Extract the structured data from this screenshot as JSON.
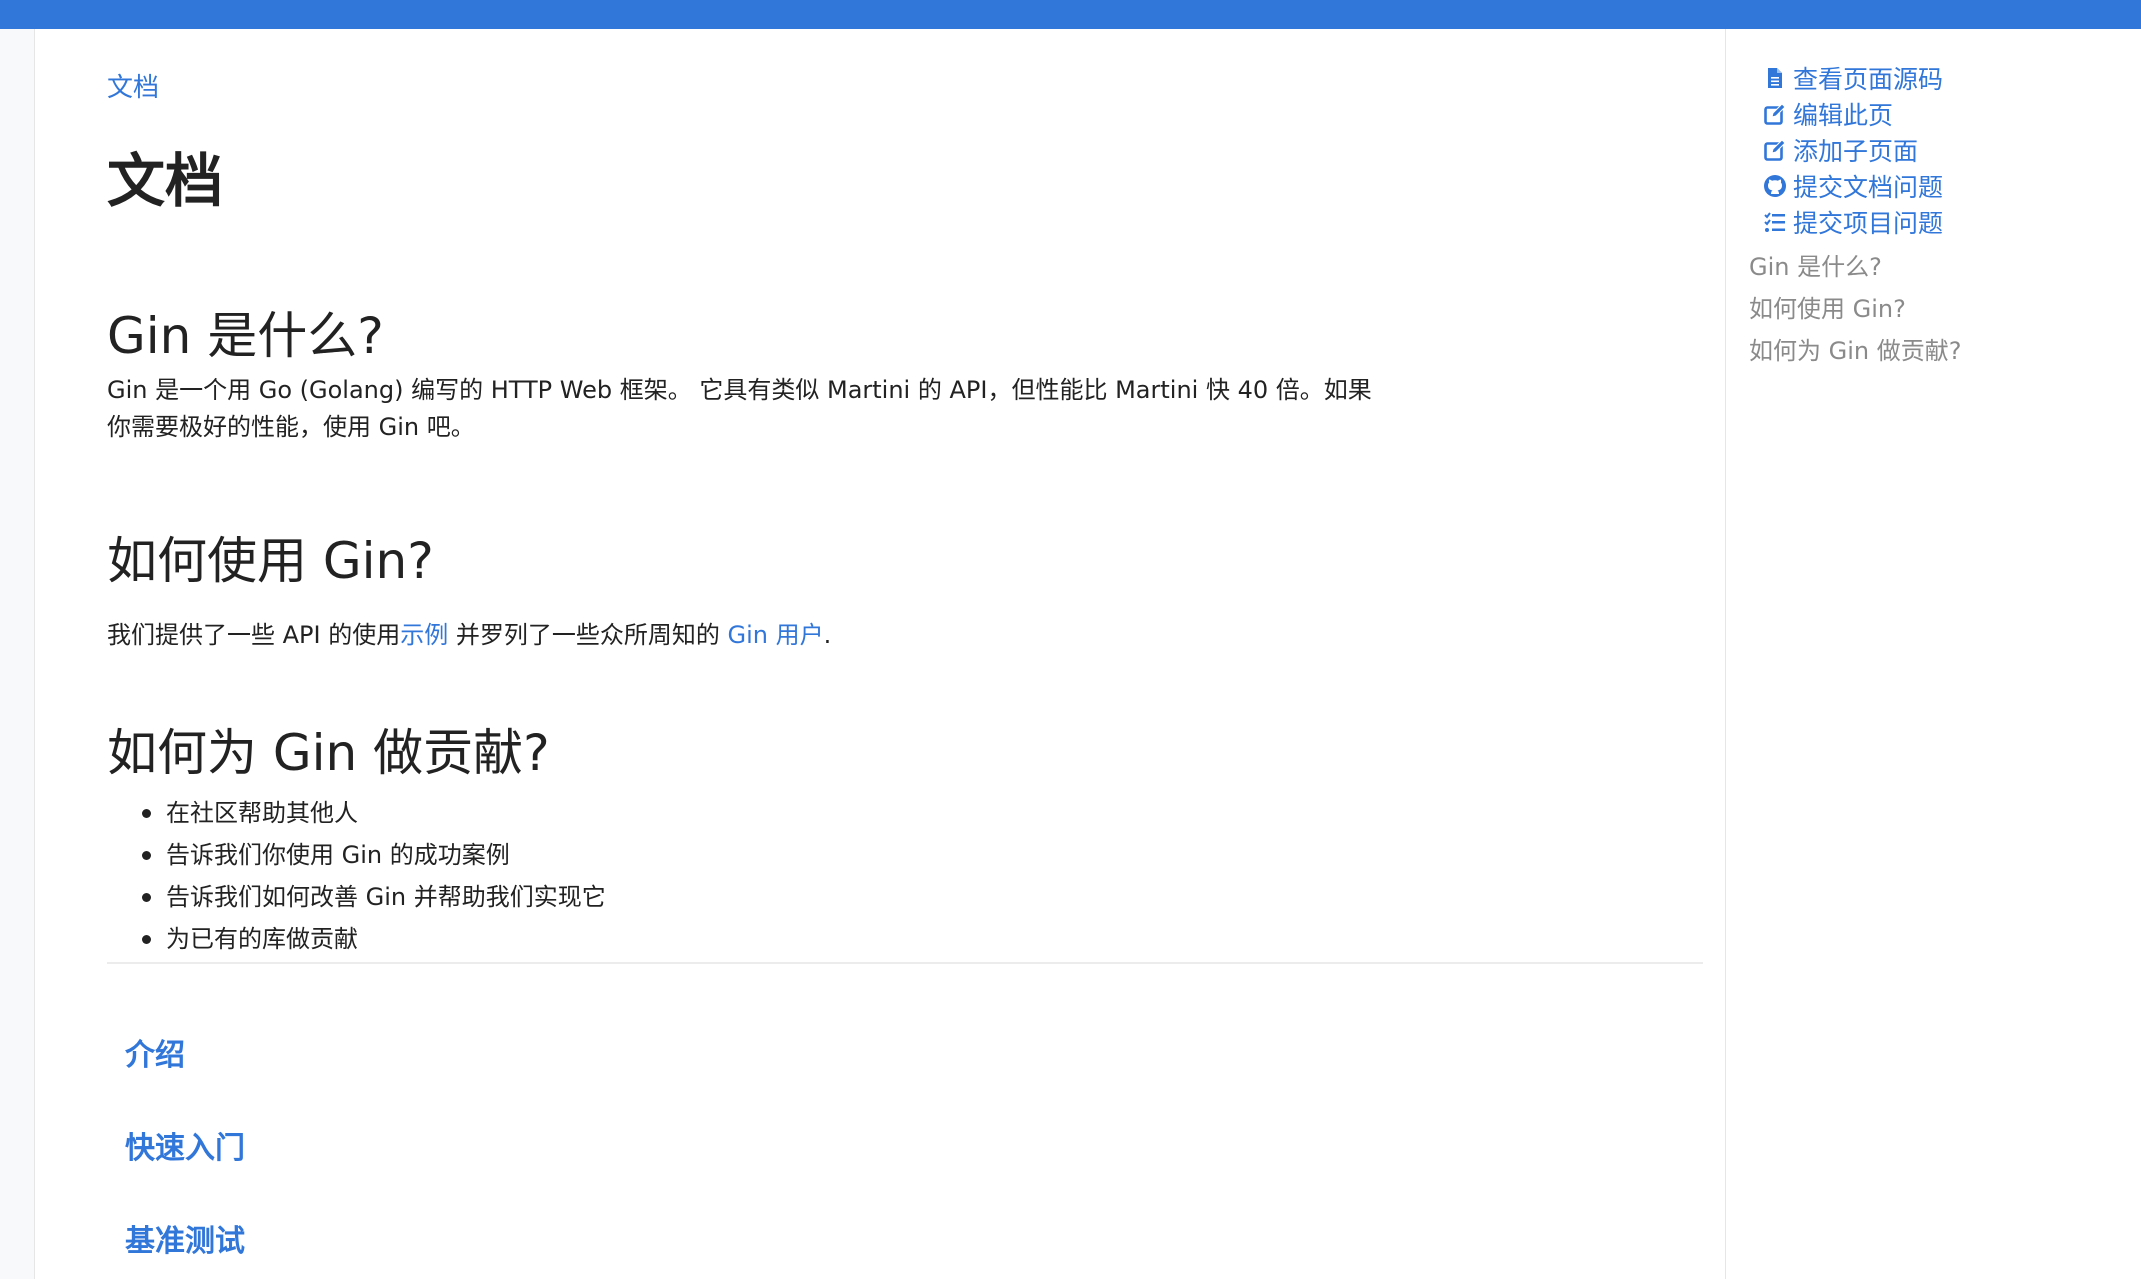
{
  "colors": {
    "accent": "#3176d9",
    "text": "#222222",
    "muted": "#8a8a8a",
    "divider": "#ececec"
  },
  "breadcrumb": "文档",
  "page_title": "文档",
  "sections": {
    "what": {
      "heading": "Gin 是什么?",
      "text": "Gin 是一个用 Go (Golang) 编写的 HTTP Web 框架。 它具有类似 Martini 的 API，但性能比 Martini 快 40 倍。如果你需要极好的性能，使用 Gin 吧。"
    },
    "how_use": {
      "heading": "如何使用 Gin?",
      "text_before": "我们提供了一些 API 的使用",
      "link_examples": "示例",
      "text_middle": " 并罗列了一些众所周知的 ",
      "link_users": "Gin 用户",
      "text_after": "."
    },
    "contribute": {
      "heading": "如何为 Gin 做贡献?",
      "items": [
        "在社区帮助其他人",
        "告诉我们你使用 Gin 的成功案例",
        "告诉我们如何改善 Gin 并帮助我们实现它",
        "为已有的库做贡献"
      ]
    }
  },
  "section_links": [
    "介绍",
    "快速入门",
    "基准测试"
  ],
  "sidebar": {
    "tools": [
      {
        "label": "查看页面源码",
        "icon": "file-icon"
      },
      {
        "label": "编辑此页",
        "icon": "edit-icon"
      },
      {
        "label": "添加子页面",
        "icon": "edit-icon"
      },
      {
        "label": "提交文档问题",
        "icon": "github-icon"
      },
      {
        "label": "提交项目问题",
        "icon": "tasks-icon"
      }
    ],
    "toc": [
      "Gin 是什么?",
      "如何使用 Gin?",
      "如何为 Gin 做贡献?"
    ]
  }
}
